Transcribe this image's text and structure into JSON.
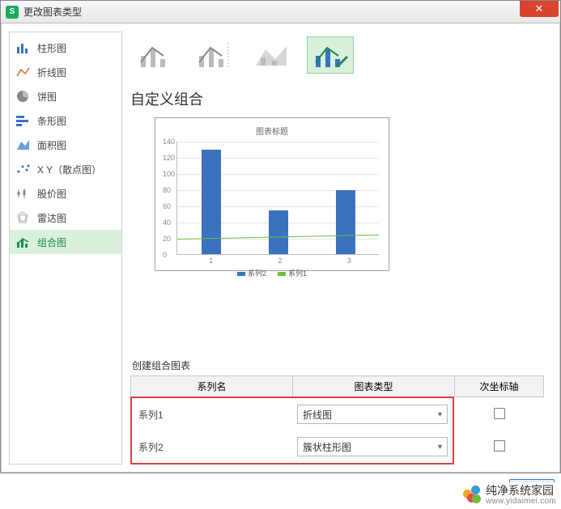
{
  "window": {
    "title": "更改图表类型"
  },
  "sidebar": {
    "items": [
      {
        "label": "柱形图"
      },
      {
        "label": "折线图"
      },
      {
        "label": "饼图"
      },
      {
        "label": "条形图"
      },
      {
        "label": "面积图"
      },
      {
        "label": "X Y（散点图）"
      },
      {
        "label": "股价图"
      },
      {
        "label": "雷达图"
      },
      {
        "label": "组合图"
      }
    ]
  },
  "section": {
    "title": "自定义组合",
    "create_label": "创建组合图表",
    "preview_title": "图表标题",
    "legend": {
      "s1": "系列1",
      "s2": "系列2"
    }
  },
  "table": {
    "headers": {
      "name": "系列名",
      "type": "图表类型",
      "axis": "次坐标轴"
    },
    "rows": [
      {
        "name": "系列1",
        "type": "折线图"
      },
      {
        "name": "系列2",
        "type": "簇状柱形图"
      }
    ]
  },
  "chart_data": {
    "type": "combo",
    "title": "图表标题",
    "categories": [
      "1",
      "2",
      "3"
    ],
    "ylim": [
      0,
      140
    ],
    "yticks": [
      0,
      20,
      40,
      60,
      80,
      100,
      120,
      140
    ],
    "series": [
      {
        "name": "系列2",
        "type": "bar",
        "values": [
          130,
          55,
          80
        ]
      },
      {
        "name": "系列1",
        "type": "line",
        "values": [
          18,
          20,
          22
        ]
      }
    ],
    "xticks": [
      "1",
      "2",
      "3"
    ]
  },
  "watermark": {
    "brand": "纯净系统家园",
    "url": "www.yidaimei.com"
  }
}
